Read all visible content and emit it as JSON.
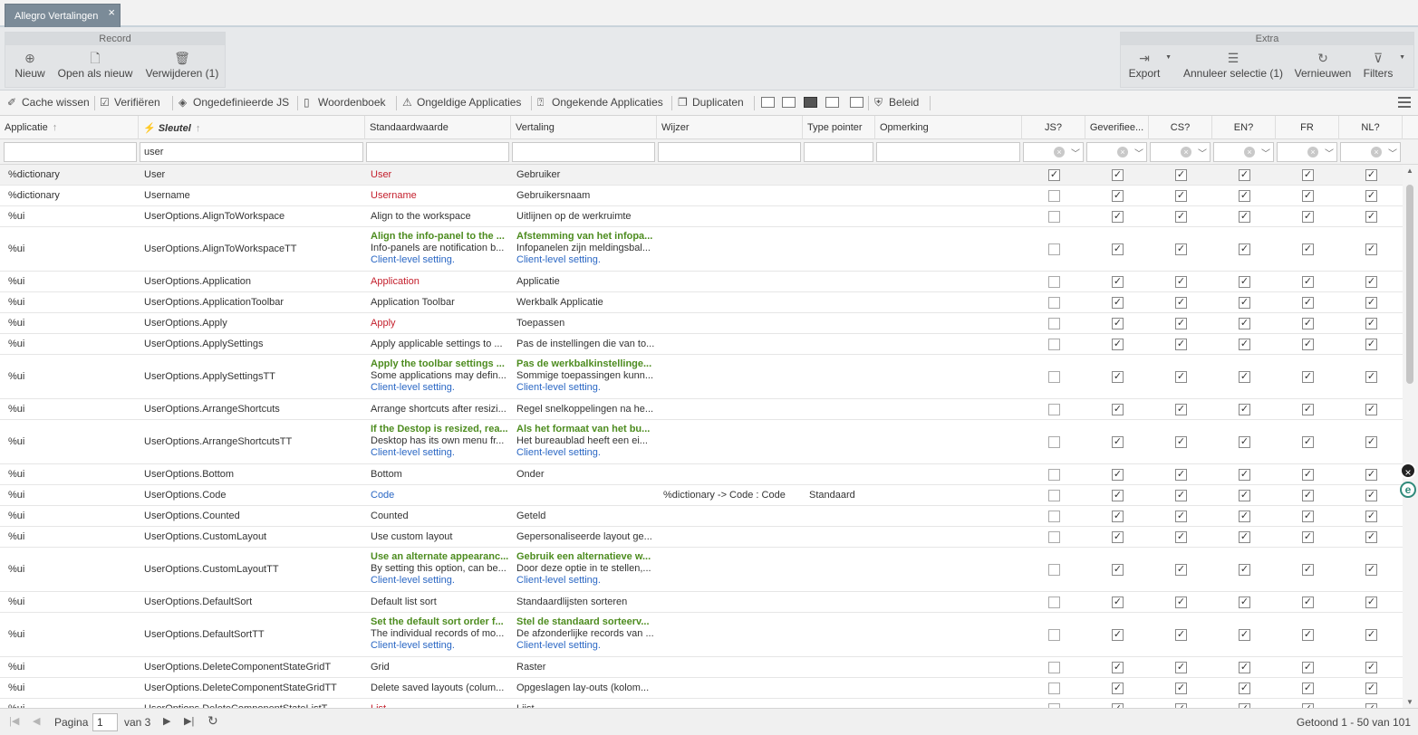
{
  "tab": {
    "title": "Allegro Vertalingen",
    "close": "×"
  },
  "ribbon": {
    "record": {
      "title": "Record",
      "buttons": [
        {
          "label": "Nieuw",
          "icon": "plus-circle-icon"
        },
        {
          "label": "Open als nieuw",
          "icon": "file-add-icon"
        },
        {
          "label": "Verwijderen (1)",
          "icon": "trash-icon"
        }
      ]
    },
    "extra": {
      "title": "Extra",
      "buttons": [
        {
          "label": "Export",
          "icon": "export-icon"
        },
        {
          "label": "Annuleer selectie (1)",
          "icon": "list-icon"
        },
        {
          "label": "Vernieuwen",
          "icon": "refresh-icon"
        },
        {
          "label": "Filters",
          "icon": "filter-icon"
        }
      ]
    }
  },
  "toolbar": {
    "items": [
      {
        "label": "Cache wissen",
        "icon": "broom-icon"
      },
      {
        "label": "Verifiëren",
        "icon": "checklist-icon"
      },
      {
        "label": "Ongedefinieerde JS",
        "icon": "layers-icon"
      },
      {
        "label": "Woordenboek",
        "icon": "book-icon"
      },
      {
        "label": "Ongeldige Applicaties",
        "icon": "warning-icon"
      },
      {
        "label": "Ongekende Applicaties",
        "icon": "question-icon"
      },
      {
        "label": "Duplicaten",
        "icon": "copy-icon"
      },
      {
        "label": "Beleid",
        "icon": "shield-icon"
      }
    ]
  },
  "columns": {
    "applicatie": "Applicatie",
    "sleutel": "Sleutel",
    "standaardwaarde": "Standaardwaarde",
    "vertaling": "Vertaling",
    "wijzer": "Wijzer",
    "type_pointer": "Type pointer",
    "opmerking": "Opmerking",
    "js": "JS?",
    "geverifieerd": "Geverifiee...",
    "cs": "CS?",
    "en": "EN?",
    "fr": "FR",
    "nl": "NL?"
  },
  "filters": {
    "sleutel": "user"
  },
  "rows": [
    {
      "app": "%dictionary",
      "key": "User",
      "std": [
        "User"
      ],
      "stdStyle": "red",
      "vert": [
        "Gebruiker"
      ],
      "wijzer": "",
      "type": "",
      "checks": [
        1,
        1,
        1,
        1,
        1,
        1
      ],
      "sel": true
    },
    {
      "app": "%dictionary",
      "key": "Username",
      "std": [
        "Username"
      ],
      "stdStyle": "red",
      "vert": [
        "Gebruikersnaam"
      ],
      "wijzer": "",
      "type": "",
      "checks": [
        0,
        1,
        1,
        1,
        1,
        1
      ]
    },
    {
      "app": "%ui",
      "key": "UserOptions.AlignToWorkspace",
      "std": [
        "Align to the workspace"
      ],
      "stdStyle": "",
      "vert": [
        "Uitlijnen op de werkruimte"
      ],
      "wijzer": "",
      "type": "",
      "checks": [
        0,
        1,
        1,
        1,
        1,
        1
      ]
    },
    {
      "app": "%ui",
      "key": "UserOptions.AlignToWorkspaceTT",
      "std": [
        "Align the info-panel to the ...",
        "Info-panels are notification b...",
        "Client-level setting."
      ],
      "vert": [
        "Afstemming van het infopa...",
        "Infopanelen zijn meldingsbal...",
        "Client-level setting."
      ],
      "multi": true,
      "wijzer": "",
      "type": "",
      "checks": [
        0,
        1,
        1,
        1,
        1,
        1
      ]
    },
    {
      "app": "%ui",
      "key": "UserOptions.Application",
      "std": [
        "Application"
      ],
      "stdStyle": "red",
      "vert": [
        "Applicatie"
      ],
      "wijzer": "",
      "type": "",
      "checks": [
        0,
        1,
        1,
        1,
        1,
        1
      ]
    },
    {
      "app": "%ui",
      "key": "UserOptions.ApplicationToolbar",
      "std": [
        "Application Toolbar"
      ],
      "stdStyle": "",
      "vert": [
        "Werkbalk Applicatie"
      ],
      "wijzer": "",
      "type": "",
      "checks": [
        0,
        1,
        1,
        1,
        1,
        1
      ]
    },
    {
      "app": "%ui",
      "key": "UserOptions.Apply",
      "std": [
        "Apply"
      ],
      "stdStyle": "red",
      "vert": [
        "Toepassen"
      ],
      "wijzer": "",
      "type": "",
      "checks": [
        0,
        1,
        1,
        1,
        1,
        1
      ]
    },
    {
      "app": "%ui",
      "key": "UserOptions.ApplySettings",
      "std": [
        "Apply applicable settings to ..."
      ],
      "stdStyle": "",
      "vert": [
        "Pas de instellingen die van to..."
      ],
      "wijzer": "",
      "type": "",
      "checks": [
        0,
        1,
        1,
        1,
        1,
        1
      ]
    },
    {
      "app": "%ui",
      "key": "UserOptions.ApplySettingsTT",
      "std": [
        "Apply the toolbar settings ...",
        "Some applications may defin...",
        "Client-level setting."
      ],
      "vert": [
        "Pas de werkbalkinstellinge...",
        "Sommige toepassingen kunn...",
        "Client-level setting."
      ],
      "multi": true,
      "wijzer": "",
      "type": "",
      "checks": [
        0,
        1,
        1,
        1,
        1,
        1
      ]
    },
    {
      "app": "%ui",
      "key": "UserOptions.ArrangeShortcuts",
      "std": [
        "Arrange shortcuts after resizi..."
      ],
      "stdStyle": "",
      "vert": [
        "Regel snelkoppelingen na he..."
      ],
      "wijzer": "",
      "type": "",
      "checks": [
        0,
        1,
        1,
        1,
        1,
        1
      ]
    },
    {
      "app": "%ui",
      "key": "UserOptions.ArrangeShortcutsTT",
      "std": [
        "If the Destop is resized, rea...",
        "Desktop has its own menu fr...",
        "Client-level setting."
      ],
      "vert": [
        "Als het formaat van het bu...",
        "Het bureaublad heeft een ei...",
        "Client-level setting."
      ],
      "multi": true,
      "wijzer": "",
      "type": "",
      "checks": [
        0,
        1,
        1,
        1,
        1,
        1
      ]
    },
    {
      "app": "%ui",
      "key": "UserOptions.Bottom",
      "std": [
        "Bottom"
      ],
      "stdStyle": "",
      "vert": [
        "Onder"
      ],
      "wijzer": "",
      "type": "",
      "checks": [
        0,
        1,
        1,
        1,
        1,
        1
      ]
    },
    {
      "app": "%ui",
      "key": "UserOptions.Code",
      "std": [
        "Code"
      ],
      "stdStyle": "blue",
      "vert": [
        ""
      ],
      "wijzer": "%dictionary -> Code : Code",
      "type": "Standaard",
      "checks": [
        0,
        1,
        1,
        1,
        1,
        1
      ]
    },
    {
      "app": "%ui",
      "key": "UserOptions.Counted",
      "std": [
        "Counted"
      ],
      "stdStyle": "",
      "vert": [
        "Geteld"
      ],
      "wijzer": "",
      "type": "",
      "checks": [
        0,
        1,
        1,
        1,
        1,
        1
      ]
    },
    {
      "app": "%ui",
      "key": "UserOptions.CustomLayout",
      "std": [
        "Use custom layout"
      ],
      "stdStyle": "",
      "vert": [
        "Gepersonaliseerde layout ge..."
      ],
      "wijzer": "",
      "type": "",
      "checks": [
        0,
        1,
        1,
        1,
        1,
        1
      ]
    },
    {
      "app": "%ui",
      "key": "UserOptions.CustomLayoutTT",
      "std": [
        "Use an alternate appearanc...",
        "By setting this option, can be...",
        "Client-level setting."
      ],
      "vert": [
        "Gebruik een alternatieve w...",
        "Door deze optie in te stellen,...",
        "Client-level setting."
      ],
      "multi": true,
      "wijzer": "",
      "type": "",
      "checks": [
        0,
        1,
        1,
        1,
        1,
        1
      ]
    },
    {
      "app": "%ui",
      "key": "UserOptions.DefaultSort",
      "std": [
        "Default list sort"
      ],
      "stdStyle": "",
      "vert": [
        "Standaardlijsten sorteren"
      ],
      "wijzer": "",
      "type": "",
      "checks": [
        0,
        1,
        1,
        1,
        1,
        1
      ]
    },
    {
      "app": "%ui",
      "key": "UserOptions.DefaultSortTT",
      "std": [
        "Set the default sort order f...",
        "The individual records of mo...",
        "Client-level setting."
      ],
      "vert": [
        "Stel de standaard sorteerv...",
        "De afzonderlijke records van ...",
        "Client-level setting."
      ],
      "multi": true,
      "wijzer": "",
      "type": "",
      "checks": [
        0,
        1,
        1,
        1,
        1,
        1
      ]
    },
    {
      "app": "%ui",
      "key": "UserOptions.DeleteComponentStateGridT",
      "std": [
        "Grid"
      ],
      "stdStyle": "",
      "vert": [
        "Raster"
      ],
      "wijzer": "",
      "type": "",
      "checks": [
        0,
        1,
        1,
        1,
        1,
        1
      ]
    },
    {
      "app": "%ui",
      "key": "UserOptions.DeleteComponentStateGridTT",
      "std": [
        "Delete saved layouts (colum..."
      ],
      "stdStyle": "",
      "vert": [
        "Opgeslagen lay-outs (kolom..."
      ],
      "wijzer": "",
      "type": "",
      "checks": [
        0,
        1,
        1,
        1,
        1,
        1
      ]
    },
    {
      "app": "%ui",
      "key": "UserOptions.DeleteComponentStateListT",
      "std": [
        "List"
      ],
      "stdStyle": "red",
      "vert": [
        "Lijst"
      ],
      "wijzer": "",
      "type": "",
      "checks": [
        0,
        1,
        1,
        1,
        1,
        1
      ]
    }
  ],
  "pager": {
    "label": "Pagina",
    "page": "1",
    "of": "van 3",
    "shown": "Getoond 1 - 50 van 101"
  },
  "side": {
    "close": "×",
    "e": "e"
  }
}
